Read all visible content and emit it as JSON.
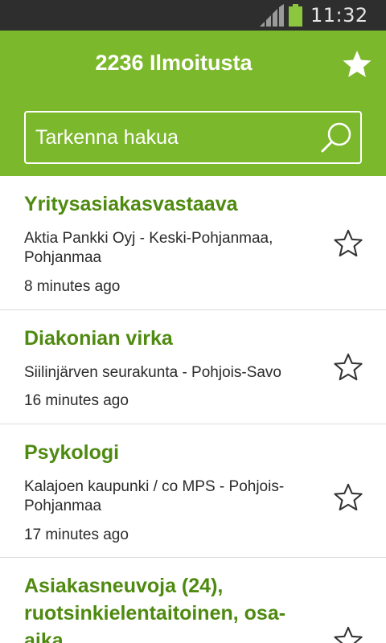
{
  "status_bar": {
    "time": "11:32",
    "signal_icon": "signal-icon",
    "battery_icon": "battery-icon",
    "battery_color": "#8cc63f"
  },
  "header": {
    "title": "2236 Ilmoitusta",
    "favorites_icon": "star-filled-icon",
    "background": "#7cb82b"
  },
  "search": {
    "placeholder": "Tarkenna hakua",
    "value": "",
    "icon": "search-icon"
  },
  "listings": [
    {
      "title": "Yritysasiakasvastaava",
      "subtitle": "Aktia Pankki Oyj - Keski-Pohjanmaa, Pohjanmaa",
      "time": "8 minutes ago",
      "favorite": false
    },
    {
      "title": "Diakonian virka",
      "subtitle": "Siilinjärven seurakunta - Pohjois-Savo",
      "time": "16 minutes ago",
      "favorite": false
    },
    {
      "title": "Psykologi",
      "subtitle": "Kalajoen kaupunki / co MPS - Pohjois-Pohjanmaa",
      "time": "17 minutes ago",
      "favorite": false
    },
    {
      "title": "Asiakasneuvoja (24), ruotsinkielentaitoinen, osa-aika",
      "subtitle": "",
      "time": "",
      "favorite": false
    }
  ],
  "colors": {
    "accent": "#7cb82b",
    "title_green": "#4f8a10",
    "text": "#2b2b2b",
    "divider": "#dcdcdc"
  }
}
